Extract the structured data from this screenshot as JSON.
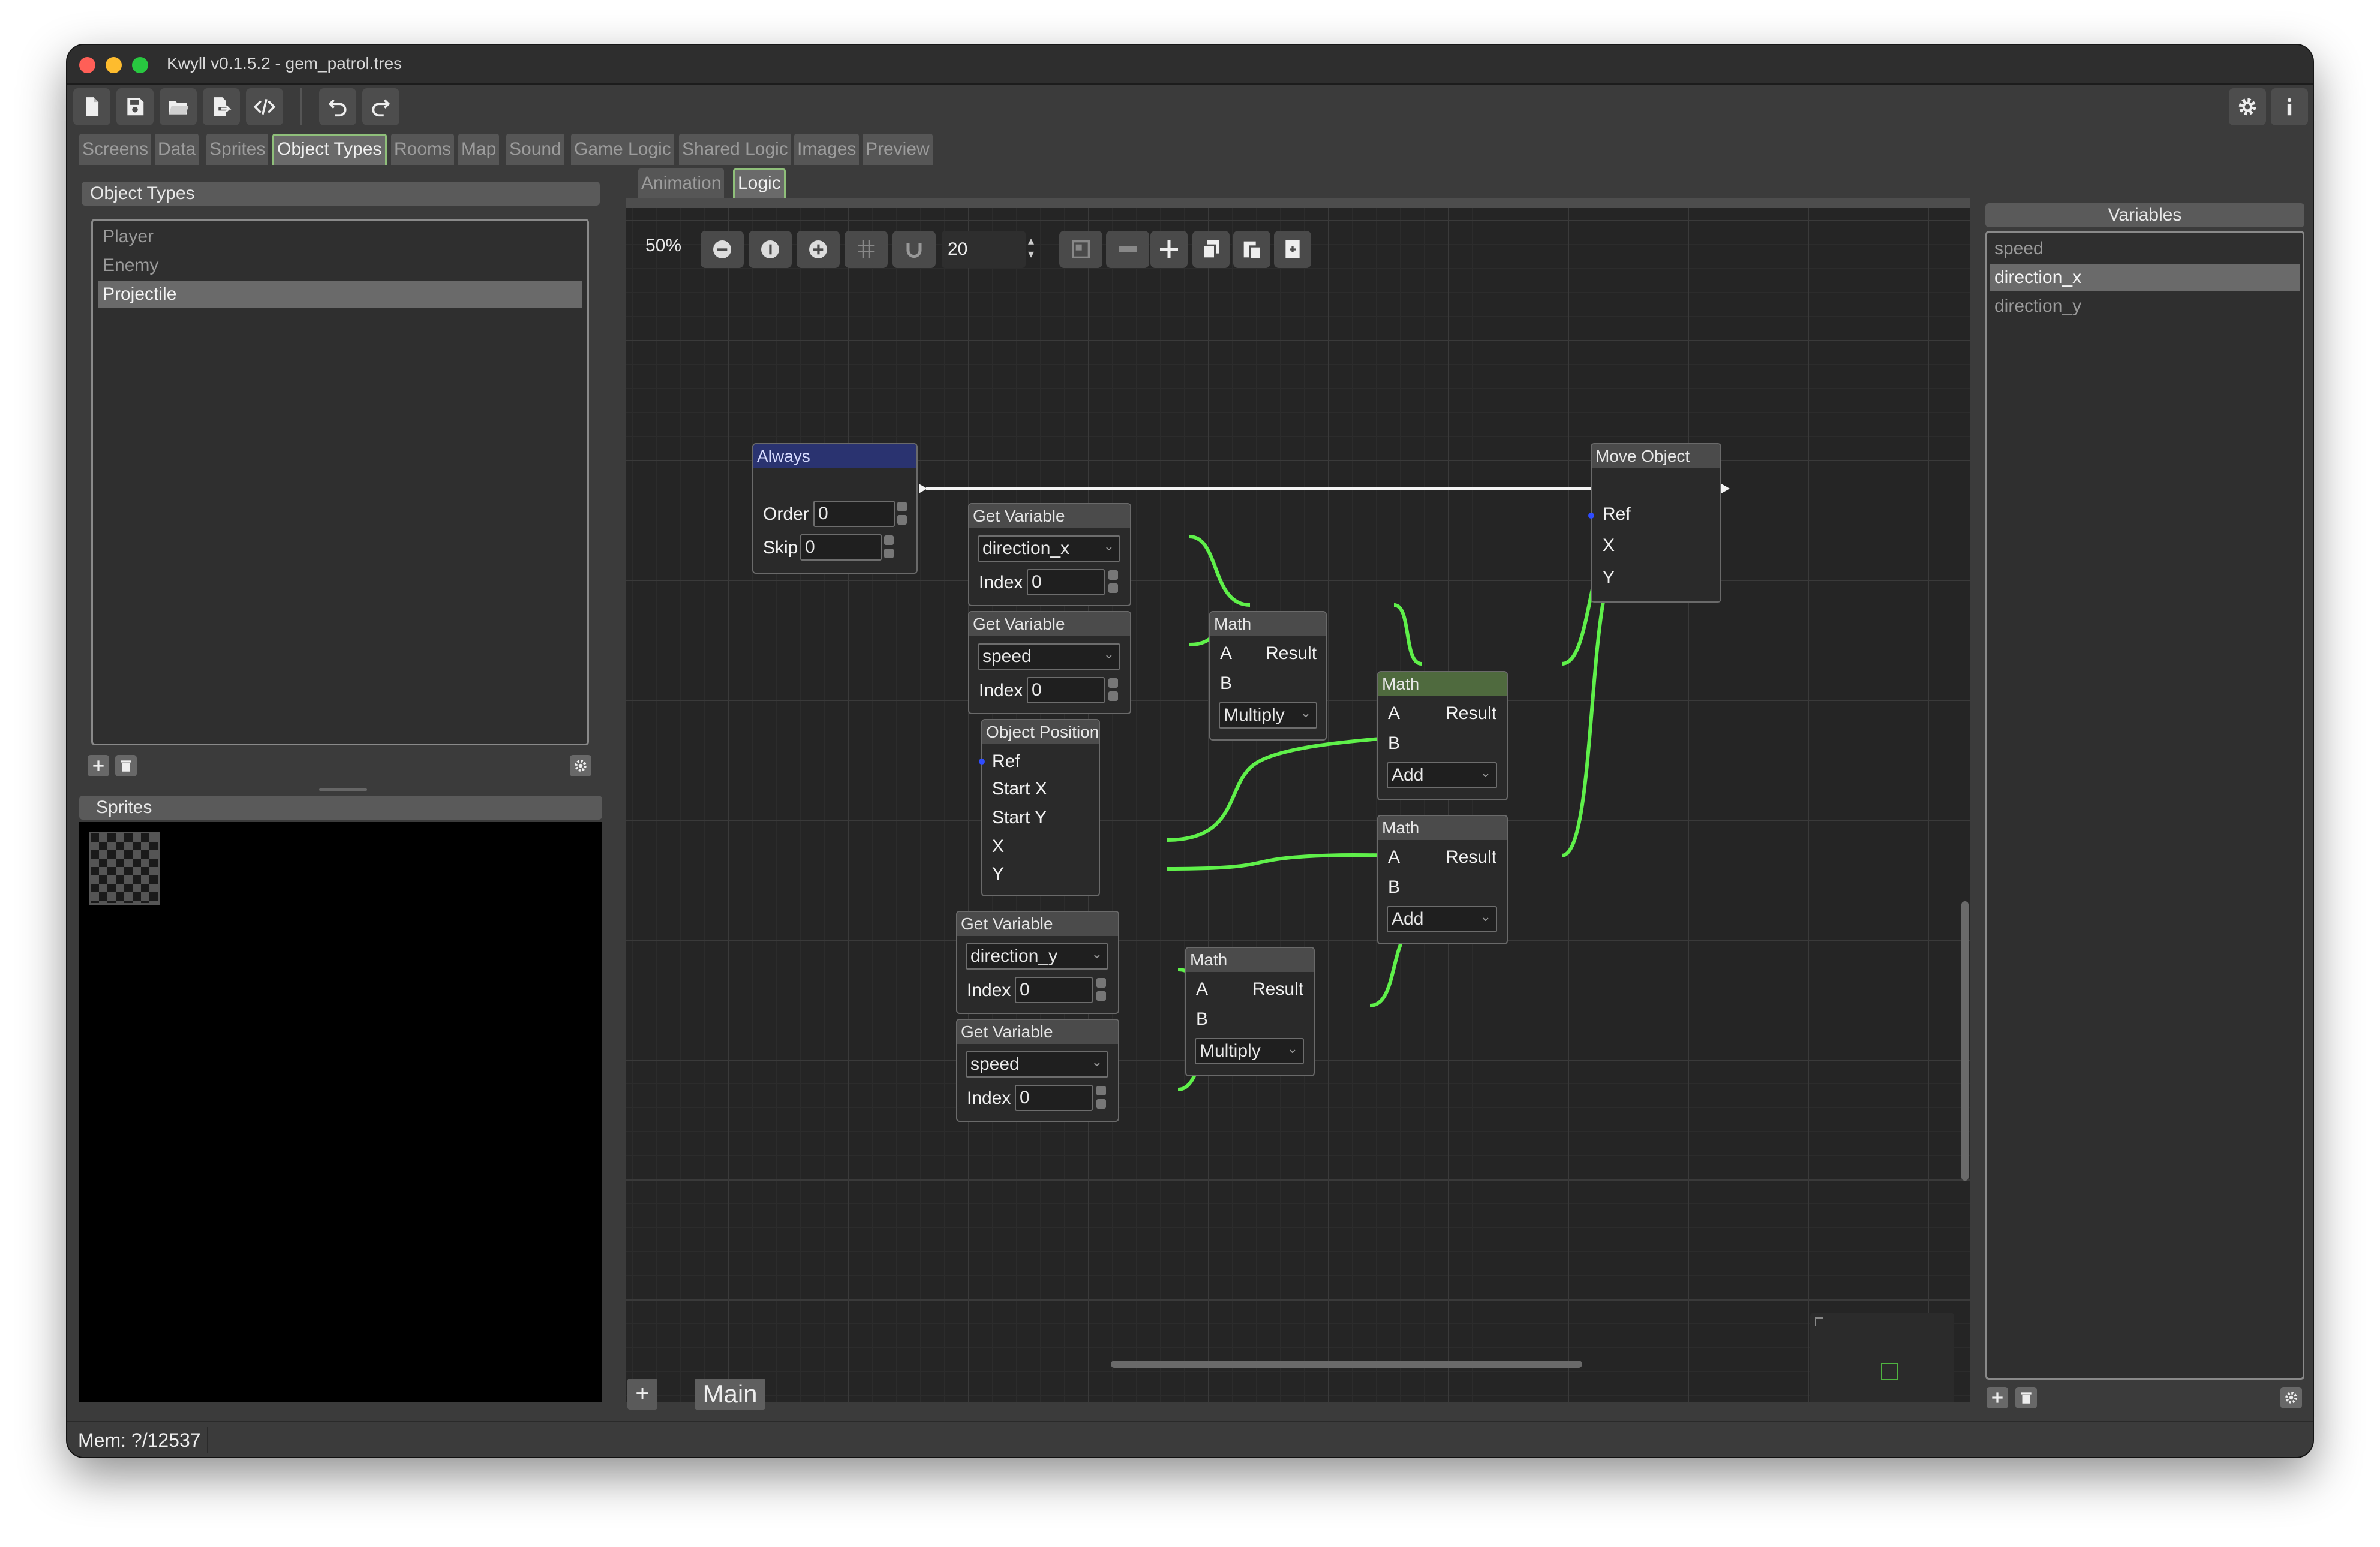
{
  "window": {
    "title": "Kwyll v0.1.5.2 - gem_patrol.tres"
  },
  "toolbar": {
    "icons": [
      "new-file-icon",
      "save-icon",
      "open-folder-icon",
      "export-icon",
      "code-icon",
      "undo-icon",
      "redo-icon",
      "settings-icon",
      "info-icon"
    ]
  },
  "tabs": [
    "Screens",
    "Data",
    "Sprites",
    "Object Types",
    "Rooms",
    "Map",
    "Sound",
    "Game Logic",
    "Shared Logic",
    "Images",
    "Preview"
  ],
  "active_tab": "Object Types",
  "subtabs": [
    "Animation",
    "Logic"
  ],
  "active_subtab": "Logic",
  "object_types": {
    "title": "Object Types",
    "items": [
      "Player",
      "Enemy",
      "Projectile"
    ],
    "selected": "Projectile"
  },
  "sprites": {
    "title": "Sprites"
  },
  "variables": {
    "title": "Variables",
    "items": [
      "speed",
      "direction_x",
      "direction_y"
    ],
    "selected": "direction_x"
  },
  "graph_toolbar": {
    "zoom": "50%",
    "grid_value": "20"
  },
  "nodes": {
    "always": {
      "title": "Always",
      "order_label": "Order",
      "order_value": "0",
      "skip_label": "Skip",
      "skip_value": "0"
    },
    "move_object": {
      "title": "Move Object",
      "ref": "Ref",
      "x": "X",
      "y": "Y"
    },
    "getvar1": {
      "title": "Get Variable",
      "var": "direction_x",
      "index_label": "Index",
      "index_value": "0"
    },
    "getvar2": {
      "title": "Get Variable",
      "var": "speed",
      "index_label": "Index",
      "index_value": "0"
    },
    "getvar3": {
      "title": "Get Variable",
      "var": "direction_y",
      "index_label": "Index",
      "index_value": "0"
    },
    "getvar4": {
      "title": "Get Variable",
      "var": "speed",
      "index_label": "Index",
      "index_value": "0"
    },
    "objpos": {
      "title": "Object Position",
      "ref": "Ref",
      "startx": "Start X",
      "starty": "Start Y",
      "x": "X",
      "y": "Y"
    },
    "math1": {
      "title": "Math",
      "a": "A",
      "b": "B",
      "result": "Result",
      "op": "Multiply"
    },
    "math2": {
      "title": "Math",
      "a": "A",
      "b": "B",
      "result": "Result",
      "op": "Add"
    },
    "math3": {
      "title": "Math",
      "a": "A",
      "b": "B",
      "result": "Result",
      "op": "Add"
    },
    "math4": {
      "title": "Math",
      "a": "A",
      "b": "B",
      "result": "Result",
      "op": "Multiply"
    }
  },
  "graph_tab": {
    "label": "Main",
    "add_label": "+"
  },
  "status": {
    "mem": "Mem: ?/12537"
  },
  "colors": {
    "window_bg": "#3b3b3b",
    "graph_bg": "#252525",
    "accent_green": "#5ff04a",
    "always_header": "#2a3370",
    "selected_math_header": "#4f6a3e",
    "tab_active_border": "#8fbf7a"
  }
}
